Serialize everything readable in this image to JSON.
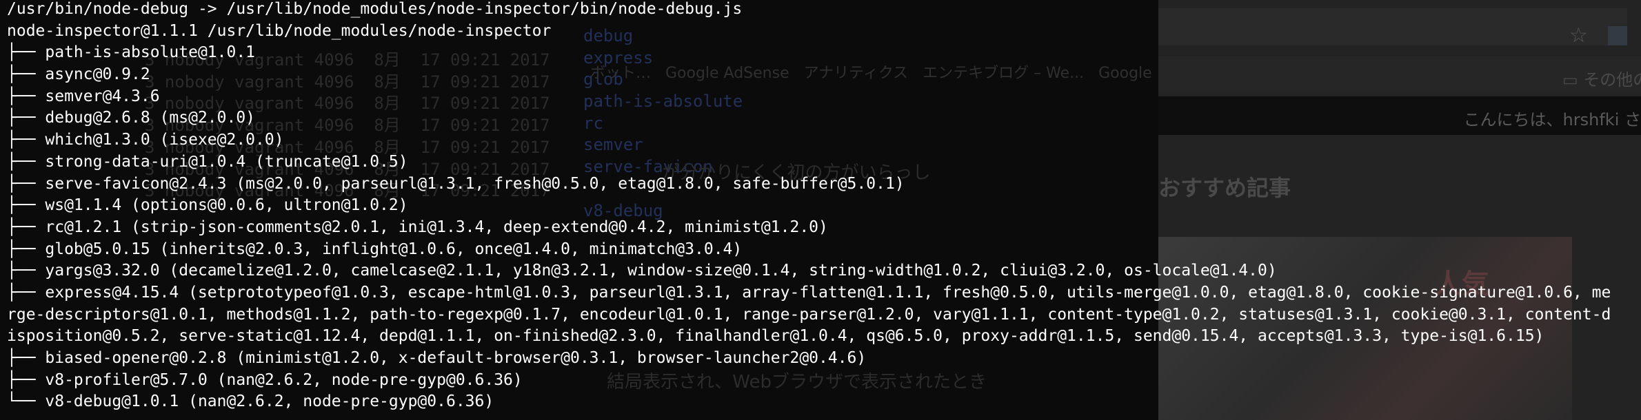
{
  "terminal": {
    "lines": [
      "/usr/bin/node-debug -> /usr/lib/node_modules/node-inspector/bin/node-debug.js",
      "node-inspector@1.1.1 /usr/lib/node_modules/node-inspector",
      "├── path-is-absolute@1.0.1",
      "├── async@0.9.2",
      "├── semver@4.3.6",
      "├── debug@2.6.8 (ms@2.0.0)",
      "├── which@1.3.0 (isexe@2.0.0)",
      "├── strong-data-uri@1.0.4 (truncate@1.0.5)",
      "├── serve-favicon@2.4.3 (ms@2.0.0, parseurl@1.3.1, fresh@0.5.0, etag@1.8.0, safe-buffer@5.0.1)",
      "├── ws@1.1.4 (options@0.0.6, ultron@1.0.2)",
      "├── rc@1.2.1 (strip-json-comments@2.0.1, ini@1.3.4, deep-extend@0.4.2, minimist@1.2.0)",
      "├── glob@5.0.15 (inherits@2.0.3, inflight@1.0.6, once@1.4.0, minimatch@3.0.4)",
      "├── yargs@3.32.0 (decamelize@1.2.0, camelcase@2.1.1, y18n@3.2.1, window-size@0.1.4, string-width@1.0.2, cliui@3.2.0, os-locale@1.4.0)",
      "├── express@4.15.4 (setprototypeof@1.0.3, escape-html@1.0.3, parseurl@1.3.1, array-flatten@1.1.1, fresh@0.5.0, utils-merge@1.0.0, etag@1.8.0, cookie-signature@1.0.6, me",
      "rge-descriptors@1.0.1, methods@1.1.2, path-to-regexp@0.1.7, encodeurl@1.0.1, range-parser@1.2.0, vary@1.1.1, content-type@1.0.2, statuses@1.3.1, cookie@0.3.1, content-d",
      "isposition@0.5.2, serve-static@1.12.4, depd@1.1.1, on-finished@2.3.0, finalhandler@1.0.4, qs@6.5.0, proxy-addr@1.1.5, send@0.15.4, accepts@1.3.3, type-is@1.6.15)",
      "├── biased-opener@0.2.8 (minimist@1.2.0, x-default-browser@0.3.1, browser-launcher2@0.4.6)",
      "├── v8-profiler@5.7.0 (nan@2.6.2, node-pre-gyp@0.6.36)",
      "└── v8-debug@1.0.1 (nan@2.6.2, node-pre-gyp@0.6.36)"
    ]
  },
  "background": {
    "listing_rows": [
      "3 nobody vagrant 4096  8月  17 09:21 2017",
      "3 nobody vagrant 4096  8月  17 09:21 2017",
      "3 nobody vagrant 4096  8月  17 09:21 2017",
      "3 nobody vagrant 4096  8月  17 09:21 2017",
      "3 nobody vagrant 4096  8月  17 09:21 2017",
      "3 nobody vagrant 4096  8月  17 09:21 2017",
      "3 nobody vagrant 4096  8月  17 09:21 2017"
    ],
    "dir_names": [
      "debug",
      "express",
      "glob",
      "path-is-absolute",
      "rc",
      "semver",
      "serve-favicon",
      "",
      "v8-debug"
    ],
    "bookmarks_text": "ボット…   Google AdSense   アナリティクス   エンテキブログ – We...   Google",
    "other_bookmarks": "その他の",
    "greeting": "こんにちは、hrshfki さ",
    "recommended_heading": "おすすめ記事",
    "article_fragment": "が分かりにくく初の方がいらっし",
    "article_fragment2": "結局表示され、Webブラウザで表示されたとき",
    "thumbnail_mark": "人気"
  },
  "colors": {
    "terminal_bg": "#0b0b0b",
    "terminal_fg": "#ffffff",
    "ghost_text": "#2b2b2b",
    "ghost_link": "#22305a"
  }
}
